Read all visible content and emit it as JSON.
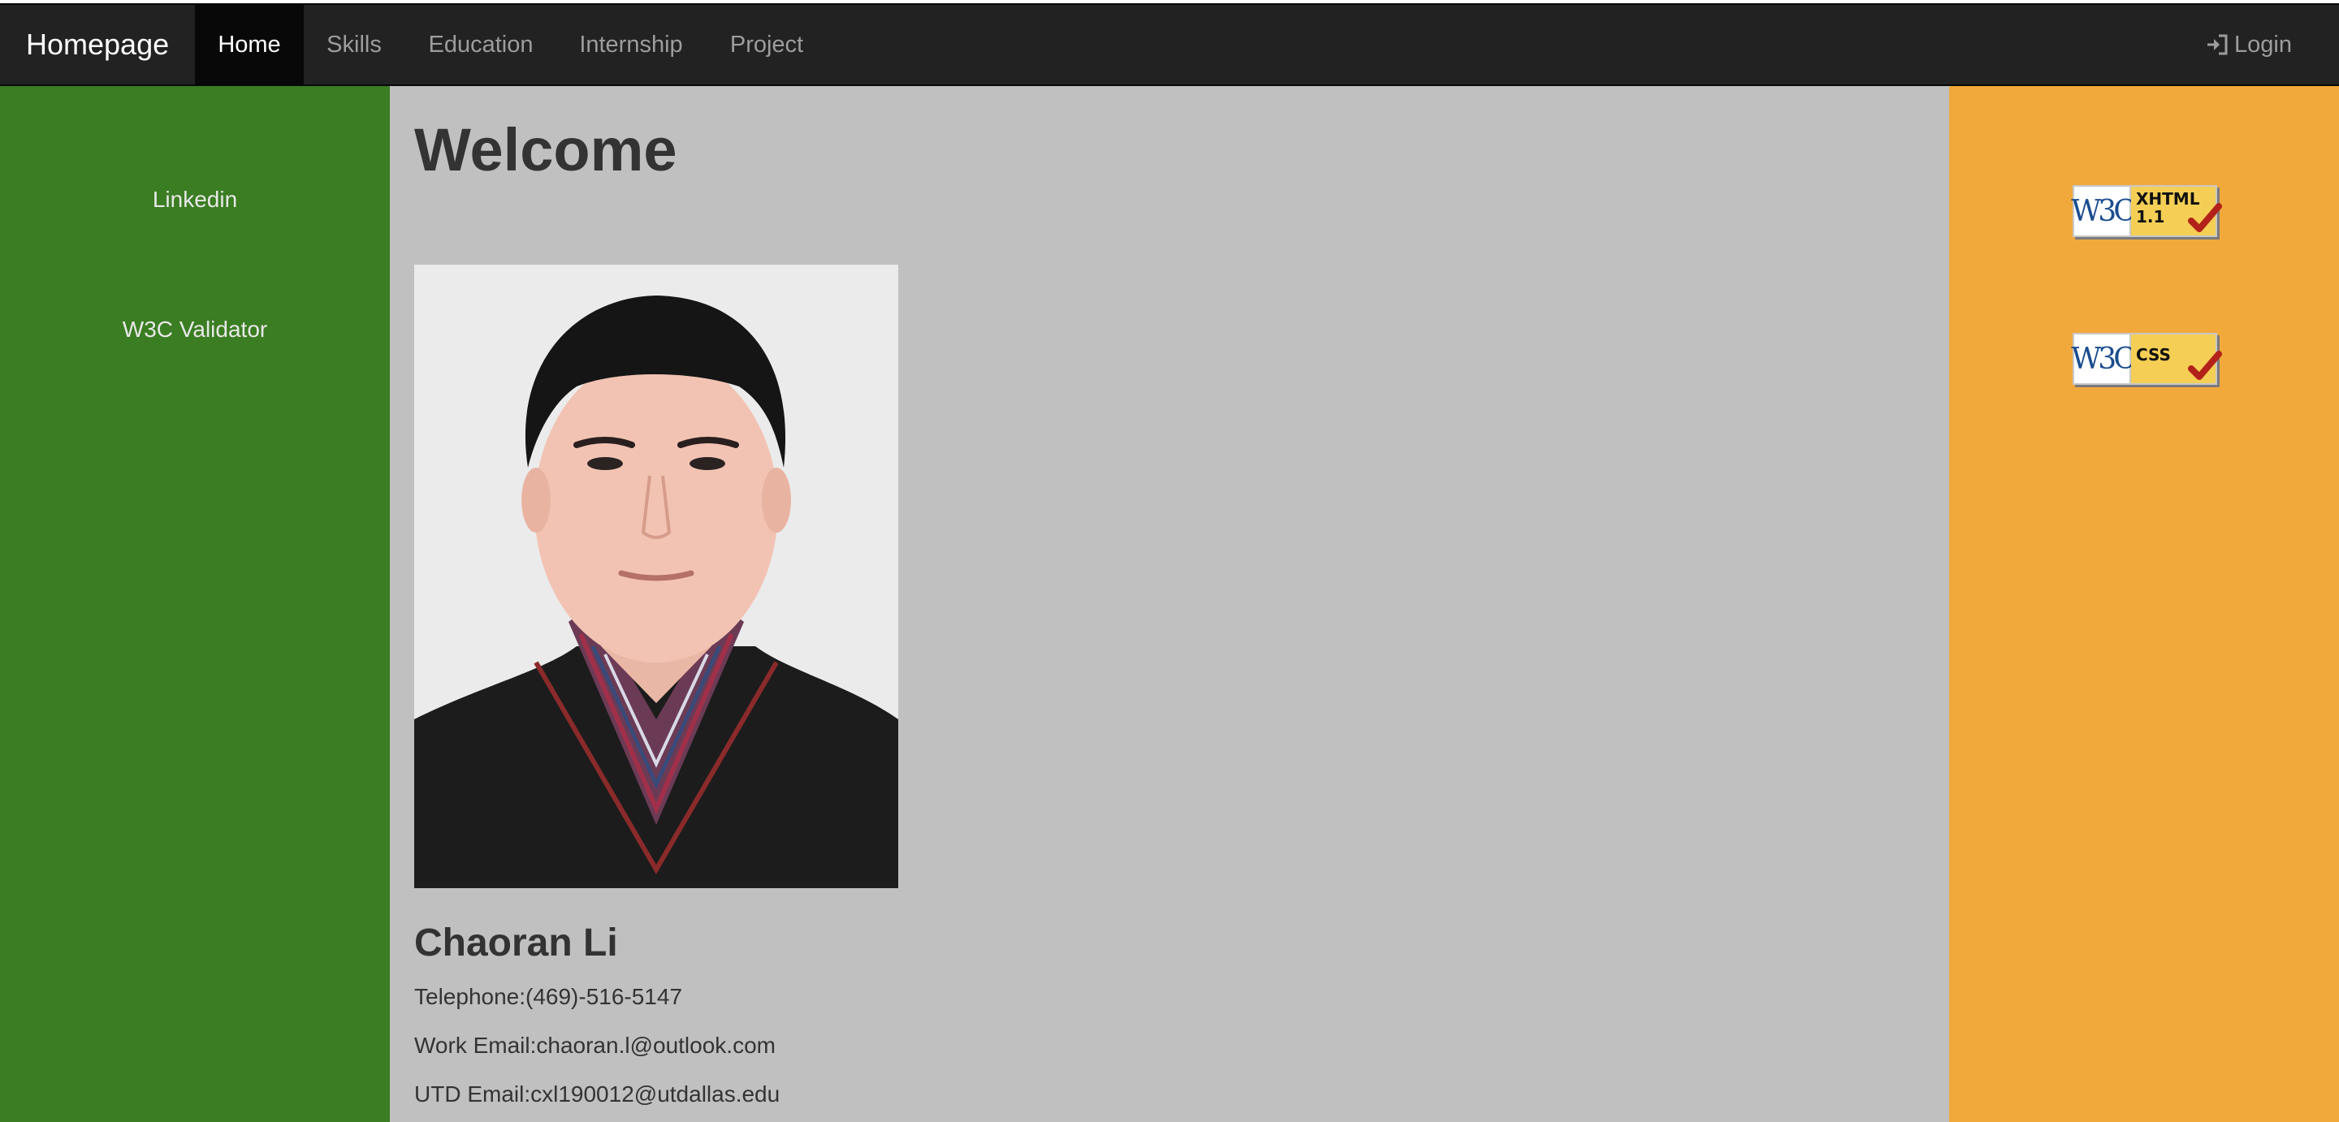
{
  "navbar": {
    "brand": "Homepage",
    "links": [
      "Home",
      "Skills",
      "Education",
      "Internship",
      "Project"
    ],
    "active_link": "Home",
    "login_label": "Login",
    "login_icon": "log-in-icon",
    "background": "#222222",
    "active_background": "#080808"
  },
  "sidebar_left": {
    "background": "#3a7d22",
    "links": [
      "Linkedin",
      "W3C Validator"
    ]
  },
  "main": {
    "background": "#c0c0c0",
    "heading": "Welcome",
    "name": "Chaoran Li",
    "contacts": [
      "Telephone:(469)-516-5147",
      "Work Email:chaoran.l@outlook.com",
      "UTD Email:cxl190012@utdallas.edu"
    ]
  },
  "sidebar_right": {
    "background": "#f2a93b",
    "badges": [
      {
        "logo": "W3C",
        "label": "XHTML\n1.1",
        "icon": "check-icon"
      },
      {
        "logo": "W3C",
        "label": "CSS",
        "icon": "check-icon"
      }
    ]
  }
}
